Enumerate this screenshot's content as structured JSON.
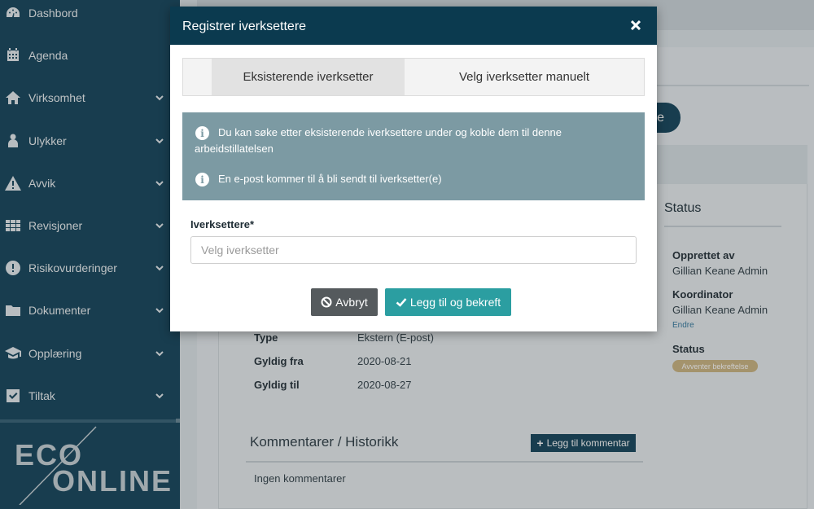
{
  "sidebar": {
    "items": [
      {
        "label": "Dashbord",
        "icon": "dashboard-icon"
      },
      {
        "label": "Agenda",
        "icon": "calendar-icon"
      },
      {
        "label": "Virksomhet",
        "icon": "home-icon"
      },
      {
        "label": "Ulykker",
        "icon": "injured-person-icon"
      },
      {
        "label": "Avvik",
        "icon": "warning-icon"
      },
      {
        "label": "Revisjoner",
        "icon": "grid-icon"
      },
      {
        "label": "Risikovurderinger",
        "icon": "exclamation-circle-icon"
      },
      {
        "label": "Dokumenter",
        "icon": "folder-icon"
      },
      {
        "label": "Opplæring",
        "icon": "graduation-cap-icon"
      },
      {
        "label": "Tiltak",
        "icon": "checkbox-icon"
      }
    ],
    "logo": {
      "line1": "ECO",
      "line2": "ONLINE"
    }
  },
  "background": {
    "pill_text": "e",
    "status_title": "Status",
    "created_by_label": "Opprettet av",
    "created_by_value": "Gillian Keane Admin",
    "coordinator_label": "Koordinator",
    "coordinator_value": "Gillian Keane Admin",
    "change_link": "Endre",
    "status_label": "Status",
    "status_badge": "Avventer bekreftelse",
    "fields": [
      {
        "label": "Type",
        "value": "Ekstern (E-post)"
      },
      {
        "label": "Gyldig fra",
        "value": "2020-08-21"
      },
      {
        "label": "Gyldig til",
        "value": "2020-08-27"
      }
    ],
    "comments_title": "Kommentarer / Historikk",
    "add_comment": "Legg til kommentar",
    "no_comments": "Ingen kommentarer"
  },
  "modal": {
    "title": "Registrer iverksettere",
    "tabs": [
      {
        "label": "Eksisterende iverksetter",
        "active": true
      },
      {
        "label": "Velg iverksetter manuelt",
        "active": false
      }
    ],
    "info_lines": [
      "Du kan søke etter eksisterende iverksettere under og koble dem til denne arbeidstillatelsen",
      "En e-post kommer til å bli sendt til iverksetter(e)"
    ],
    "field_label": "Iverksettere*",
    "field_placeholder": "Velg iverksetter",
    "cancel_label": "Avbryt",
    "confirm_label": "Legg til og bekreft"
  },
  "colors": {
    "sidebar_bg": "#1f4d63",
    "modal_header": "#0b3a4f",
    "info_bg": "#7c9aa3",
    "confirm_btn": "#2b9ea1",
    "cancel_btn": "#555a5d"
  }
}
